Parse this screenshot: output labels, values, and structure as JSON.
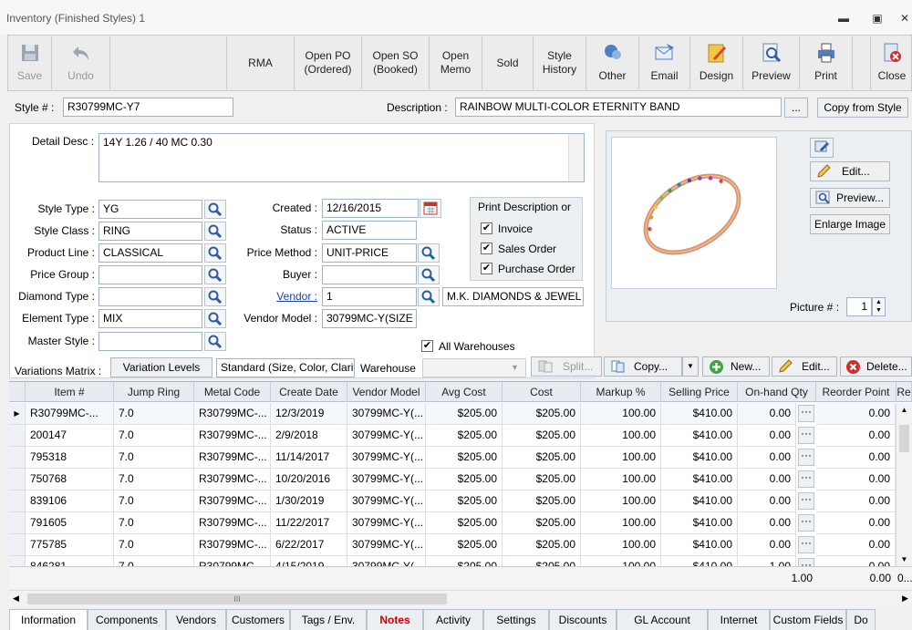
{
  "window": {
    "title": "Inventory (Finished Styles) 1"
  },
  "toolbar": {
    "save": "Save",
    "undo": "Undo",
    "rma": "RMA",
    "open_po_1": "Open PO",
    "open_po_2": "(Ordered)",
    "open_so_1": "Open SO",
    "open_so_2": "(Booked)",
    "open_memo_1": "Open",
    "open_memo_2": "Memo",
    "sold": "Sold",
    "style_history_1": "Style",
    "style_history_2": "History",
    "other": "Other",
    "email": "Email",
    "design": "Design",
    "preview": "Preview",
    "print": "Print",
    "close": "Close"
  },
  "style": {
    "style_no_label": "Style # :",
    "style_no": "R30799MC-Y7",
    "description_label": "Description :",
    "description": "RAINBOW MULTI-COLOR ETERNITY BAND",
    "ellipsis": "...",
    "copy_from_style": "Copy from Style"
  },
  "detail": {
    "label": "Detail Desc :",
    "value": "14Y 1.26 / 40 MC 0.30"
  },
  "fields": {
    "style_type_label": "Style Type :",
    "style_type": "YG",
    "style_class_label": "Style Class :",
    "style_class": "RING",
    "product_line_label": "Product Line :",
    "product_line": "CLASSICAL",
    "price_group_label": "Price Group :",
    "price_group": "",
    "diamond_type_label": "Diamond Type :",
    "diamond_type": "",
    "element_type_label": "Element Type :",
    "element_type": "MIX",
    "master_style_label": "Master Style :",
    "master_style": "",
    "created_label": "Created :",
    "created": "12/16/2015",
    "status_label": "Status :",
    "status": "ACTIVE",
    "price_method_label": "Price Method :",
    "price_method": "UNIT-PRICE",
    "buyer_label": "Buyer :",
    "buyer": "",
    "vendor_label": "Vendor :",
    "vendor": "1",
    "vendor_name": "M.K. DIAMONDS & JEWEL",
    "vendor_model_label": "Vendor Model :",
    "vendor_model": "30799MC-Y(SIZE"
  },
  "print_desc": {
    "title": "Print Description or",
    "invoice": "Invoice",
    "sales_order": "Sales Order",
    "purchase_order": "Purchase Order"
  },
  "picture": {
    "edit": "Edit...",
    "preview": "Preview...",
    "enlarge": "Enlarge Image",
    "picture_no_label": "Picture # :",
    "picture_no": "1"
  },
  "variations": {
    "label": "Variations Matrix :",
    "levels_button": "Variation Levels",
    "levels_value": "Standard (Size, Color, Clarit",
    "warehouse_label": "Warehouse",
    "all_warehouses": "All Warehouses",
    "split": "Split...",
    "copy": "Copy...",
    "new": "New...",
    "edit": "Edit...",
    "delete": "Delete..."
  },
  "grid": {
    "columns": [
      "Item #",
      "Jump Ring",
      "Metal Code",
      "Create Date",
      "Vendor Model",
      "Avg Cost",
      "Cost",
      "Markup %",
      "Selling Price",
      "On-hand Qty",
      "Reorder Point",
      "Re"
    ],
    "rows": [
      [
        "R30799MC-...",
        "7.0",
        "R30799MC-...",
        "12/3/2019",
        "30799MC-Y(...",
        "$205.00",
        "$205.00",
        "100.00",
        "$410.00",
        "0.00",
        "0.00"
      ],
      [
        "200147",
        "7.0",
        "R30799MC-...",
        "2/9/2018",
        "30799MC-Y(...",
        "$205.00",
        "$205.00",
        "100.00",
        "$410.00",
        "0.00",
        "0.00"
      ],
      [
        "795318",
        "7.0",
        "R30799MC-...",
        "11/14/2017",
        "30799MC-Y(...",
        "$205.00",
        "$205.00",
        "100.00",
        "$410.00",
        "0.00",
        "0.00"
      ],
      [
        "750768",
        "7.0",
        "R30799MC-...",
        "10/20/2016",
        "30799MC-Y(...",
        "$205.00",
        "$205.00",
        "100.00",
        "$410.00",
        "0.00",
        "0.00"
      ],
      [
        "839106",
        "7.0",
        "R30799MC-...",
        "1/30/2019",
        "30799MC-Y(...",
        "$205.00",
        "$205.00",
        "100.00",
        "$410.00",
        "0.00",
        "0.00"
      ],
      [
        "791605",
        "7.0",
        "R30799MC-...",
        "11/22/2017",
        "30799MC-Y(...",
        "$205.00",
        "$205.00",
        "100.00",
        "$410.00",
        "0.00",
        "0.00"
      ],
      [
        "775785",
        "7.0",
        "R30799MC-...",
        "6/22/2017",
        "30799MC-Y(...",
        "$205.00",
        "$205.00",
        "100.00",
        "$410.00",
        "0.00",
        "0.00"
      ],
      [
        "846281",
        "7.0",
        "R30799MC-...",
        "4/15/2019",
        "30799MC-Y(...",
        "$205.00",
        "$205.00",
        "100.00",
        "$410.00",
        "1.00",
        "0.00"
      ]
    ],
    "totals": {
      "onhand": "1.00",
      "reorder": "0.00",
      "last": "0..."
    },
    "scroll_grip": "III"
  },
  "tabs": [
    "Information",
    "Components",
    "Vendors",
    "Customers",
    "Tags / Env.",
    "Notes",
    "Activity",
    "Settings",
    "Discounts",
    "GL Account",
    "Internet",
    "Custom Fields",
    "Do"
  ],
  "colors": {
    "notes_tab": "#cc0000",
    "vendor_link": "#1a3fb0",
    "field_border": "#9fb2c6",
    "header_bg": "#e8ecf1",
    "ring_gold": "#d9956e"
  }
}
